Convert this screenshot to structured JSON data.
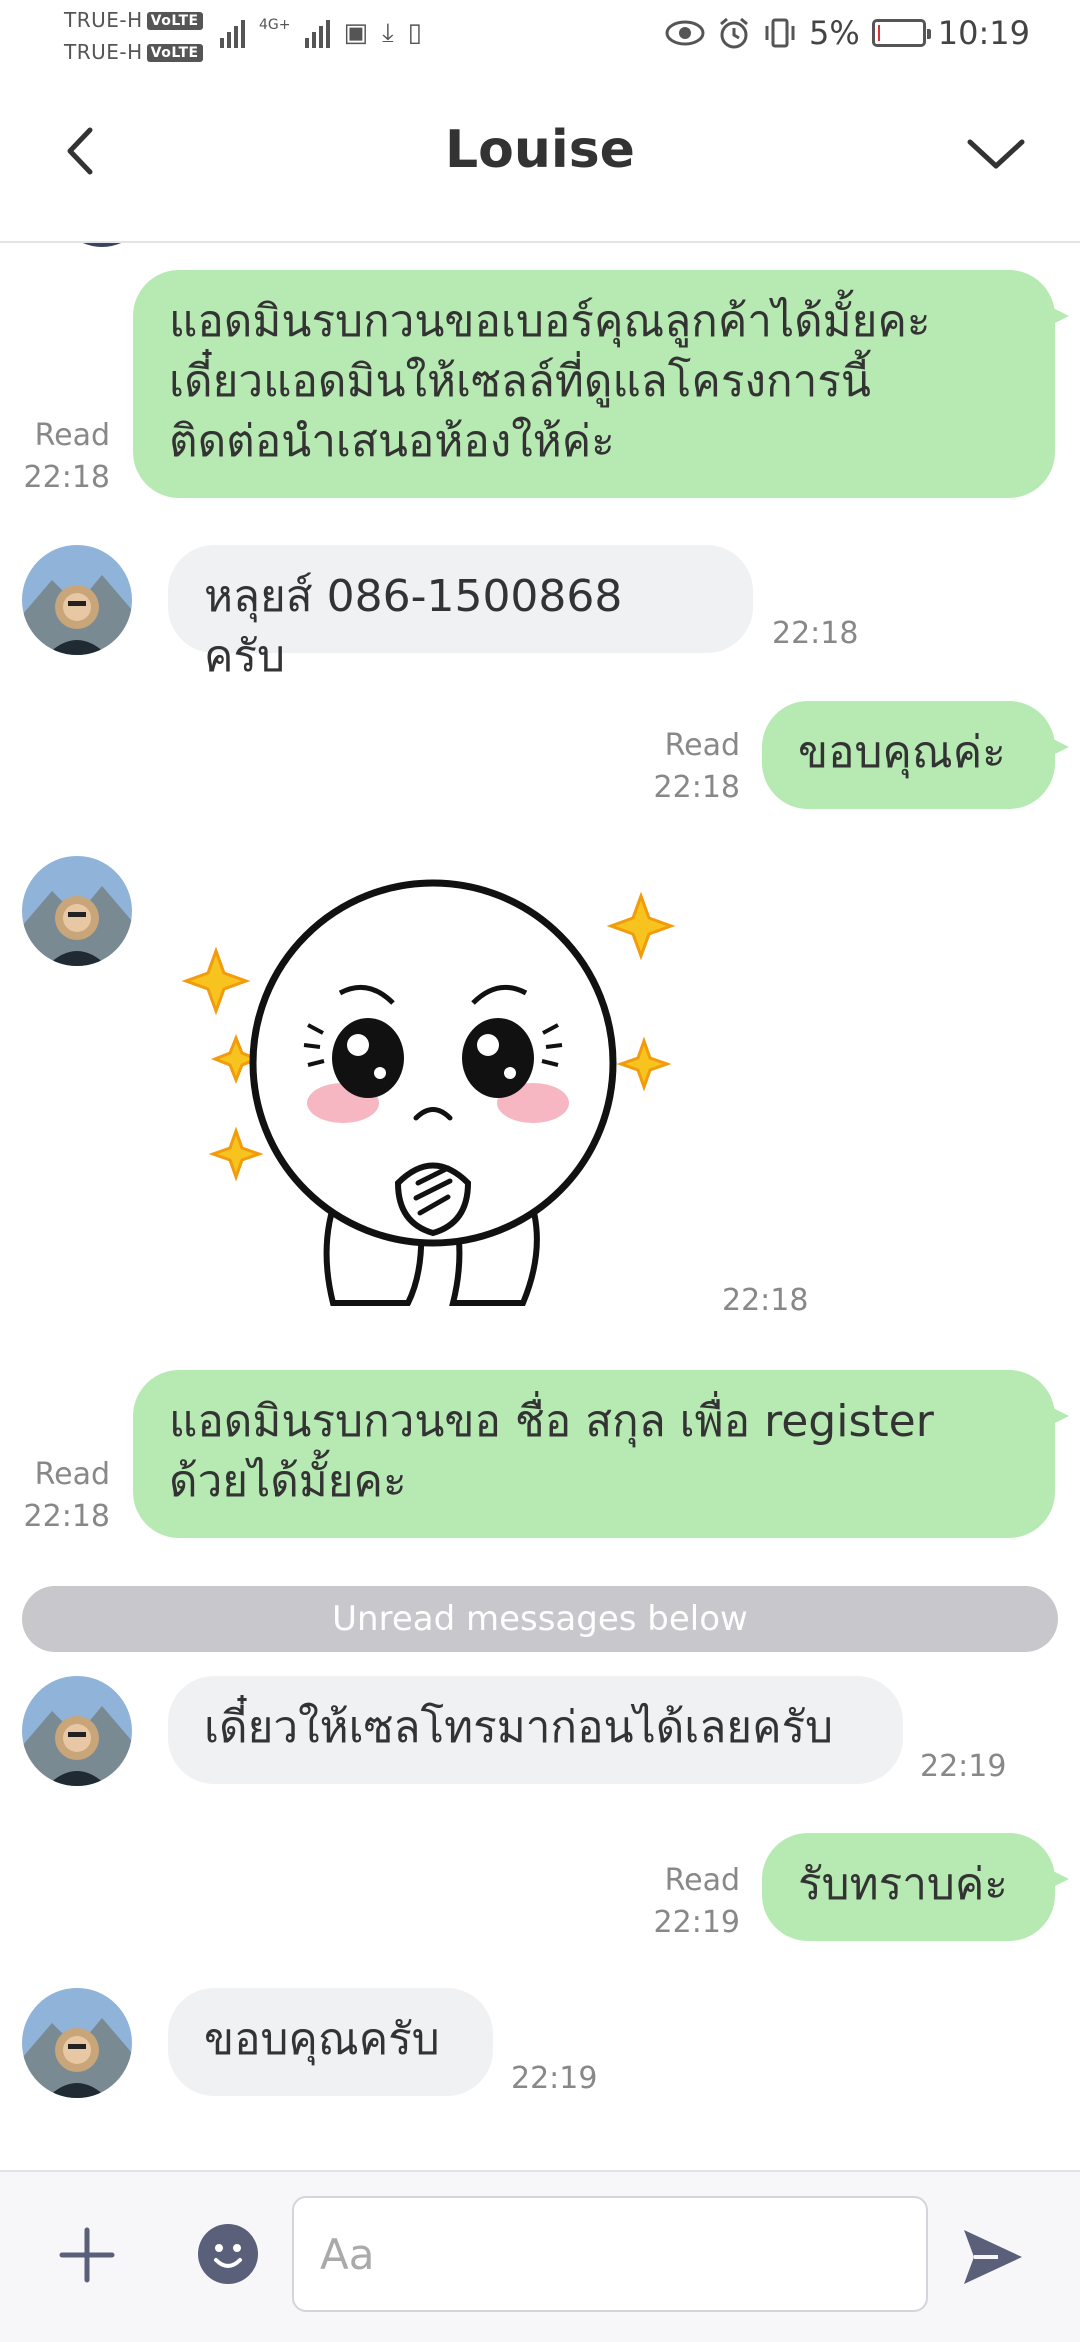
{
  "status_bar": {
    "carrier_1": "TRUE-H",
    "carrier_2": "TRUE-H",
    "volte": "VoLTE",
    "network": "4G+",
    "battery_percent": "5%",
    "battery_level": 0.05,
    "time": "10:19"
  },
  "header": {
    "title": "Louise",
    "back_icon": "chevron-left-icon",
    "menu_icon": "chevron-down-icon"
  },
  "messages": [
    {
      "dir": "out",
      "lines": [
        "แอดมินรบกวนขอเบอร์คุณลูกค้าได้มั้ยคะ",
        "เดี๋ยวแอดมินให้เซลล์ที่ดูแลโครงการนี้",
        "ติดต่อนำเสนอห้องให้ค่ะ"
      ],
      "read": "Read",
      "time": "22:18"
    },
    {
      "dir": "in",
      "text": "หลุยส์ 086-1500868 ครับ",
      "time": "22:18"
    },
    {
      "dir": "out",
      "text": "ขอบคุณค่ะ",
      "read": "Read",
      "time": "22:18"
    },
    {
      "dir": "in",
      "sticker": "cony-pleading-sticker",
      "time": "22:18"
    },
    {
      "dir": "out",
      "lines": [
        "แอดมินรบกวนขอ ชื่อ สกุล เพื่อ register",
        "ด้วยได้มั้ยคะ"
      ],
      "read": "Read",
      "time": "22:18"
    },
    {
      "dir": "in",
      "text": "เดี๋ยวให้เซลโทรมาก่อนได้เลยครับ",
      "time": "22:19"
    },
    {
      "dir": "out",
      "text": "รับทราบค่ะ",
      "read": "Read",
      "time": "22:19"
    },
    {
      "dir": "in",
      "text": "ขอบคุณครับ",
      "time": "22:19"
    }
  ],
  "unread_divider": "Unread messages below",
  "input_bar": {
    "placeholder": "Aa",
    "plus_icon": "plus-icon",
    "emoji_icon": "emoji-icon",
    "send_icon": "send-icon"
  },
  "colors": {
    "outgoing_bubble": "#b7e9b3",
    "incoming_bubble": "#f0f1f3",
    "divider": "#c8c8cc"
  }
}
